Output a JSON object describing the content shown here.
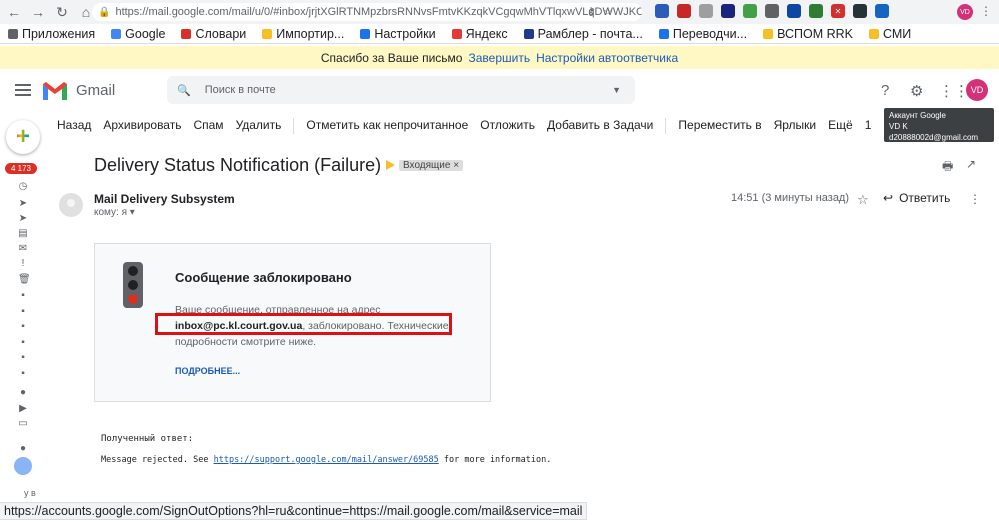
{
  "browser": {
    "url": "https://mail.google.com/mail/u/0/#inbox/jrjtXGlRTNMpzbrsRNNvsFmtvKKzqkVCgqwMhVTlqxwVLqDWWJKCWWWvRc R...",
    "extensions": [
      "uaa",
      "pad",
      "shield",
      "box",
      "tree",
      "gear",
      "moon",
      "check",
      "x",
      "arrow",
      "iD"
    ],
    "profile_initials": "VD",
    "bookmarks": [
      "Приложения",
      "Google",
      "Словари",
      "Импортир...",
      "Настройки",
      "Яндекс",
      "Рамблер - почта...",
      "Переводчи...",
      "ВСПОМ RRK",
      "СМИ"
    ]
  },
  "banner": {
    "text": "Спасибо за Ваше письмо",
    "link1": "Завершить",
    "link2": "Настройки автоответчика"
  },
  "header": {
    "app_name": "Gmail",
    "search_placeholder": "Поиск в почте",
    "avatar_initials": "VD",
    "tooltip_title": "Аккаунт Google",
    "tooltip_name": "VD K",
    "tooltip_email": "d20888002d@gmail.com"
  },
  "toolbar": {
    "items": [
      "Назад",
      "Архивировать",
      "Спам",
      "Удалить",
      "Отметить как непрочитанное",
      "Отложить",
      "Добавить в Задачи",
      "Переместить в",
      "Ярлыки",
      "Ещё",
      "1"
    ]
  },
  "rail": {
    "unread_count": "4 173",
    "label": "у в"
  },
  "message": {
    "subject": "Delivery Status Notification (Failure)",
    "label": "Входящие ×",
    "sender": "Mail Delivery Subsystem",
    "to": "кому: я ▾",
    "time": "14:51 (3 минуты назад)",
    "reply_label": "Ответить"
  },
  "card": {
    "title": "Сообщение заблокировано",
    "body_prefix": "Ваше сообщение, отправленное на адрес",
    "address": "inbox@pc.kl.court.gov.ua",
    "body_suffix": ", заблокировано. Технические подробности смотрите ниже.",
    "more": "ПОДРОБНЕЕ..."
  },
  "response": {
    "title": "Полученный ответ:",
    "prefix": "Message rejected. See ",
    "link": "https://support.google.com/mail/answer/69585",
    "suffix": " for more information."
  },
  "statusbar": {
    "text": "https://accounts.google.com/SignOutOptions?hl=ru&continue=https://mail.google.com/mail&service=mail"
  }
}
